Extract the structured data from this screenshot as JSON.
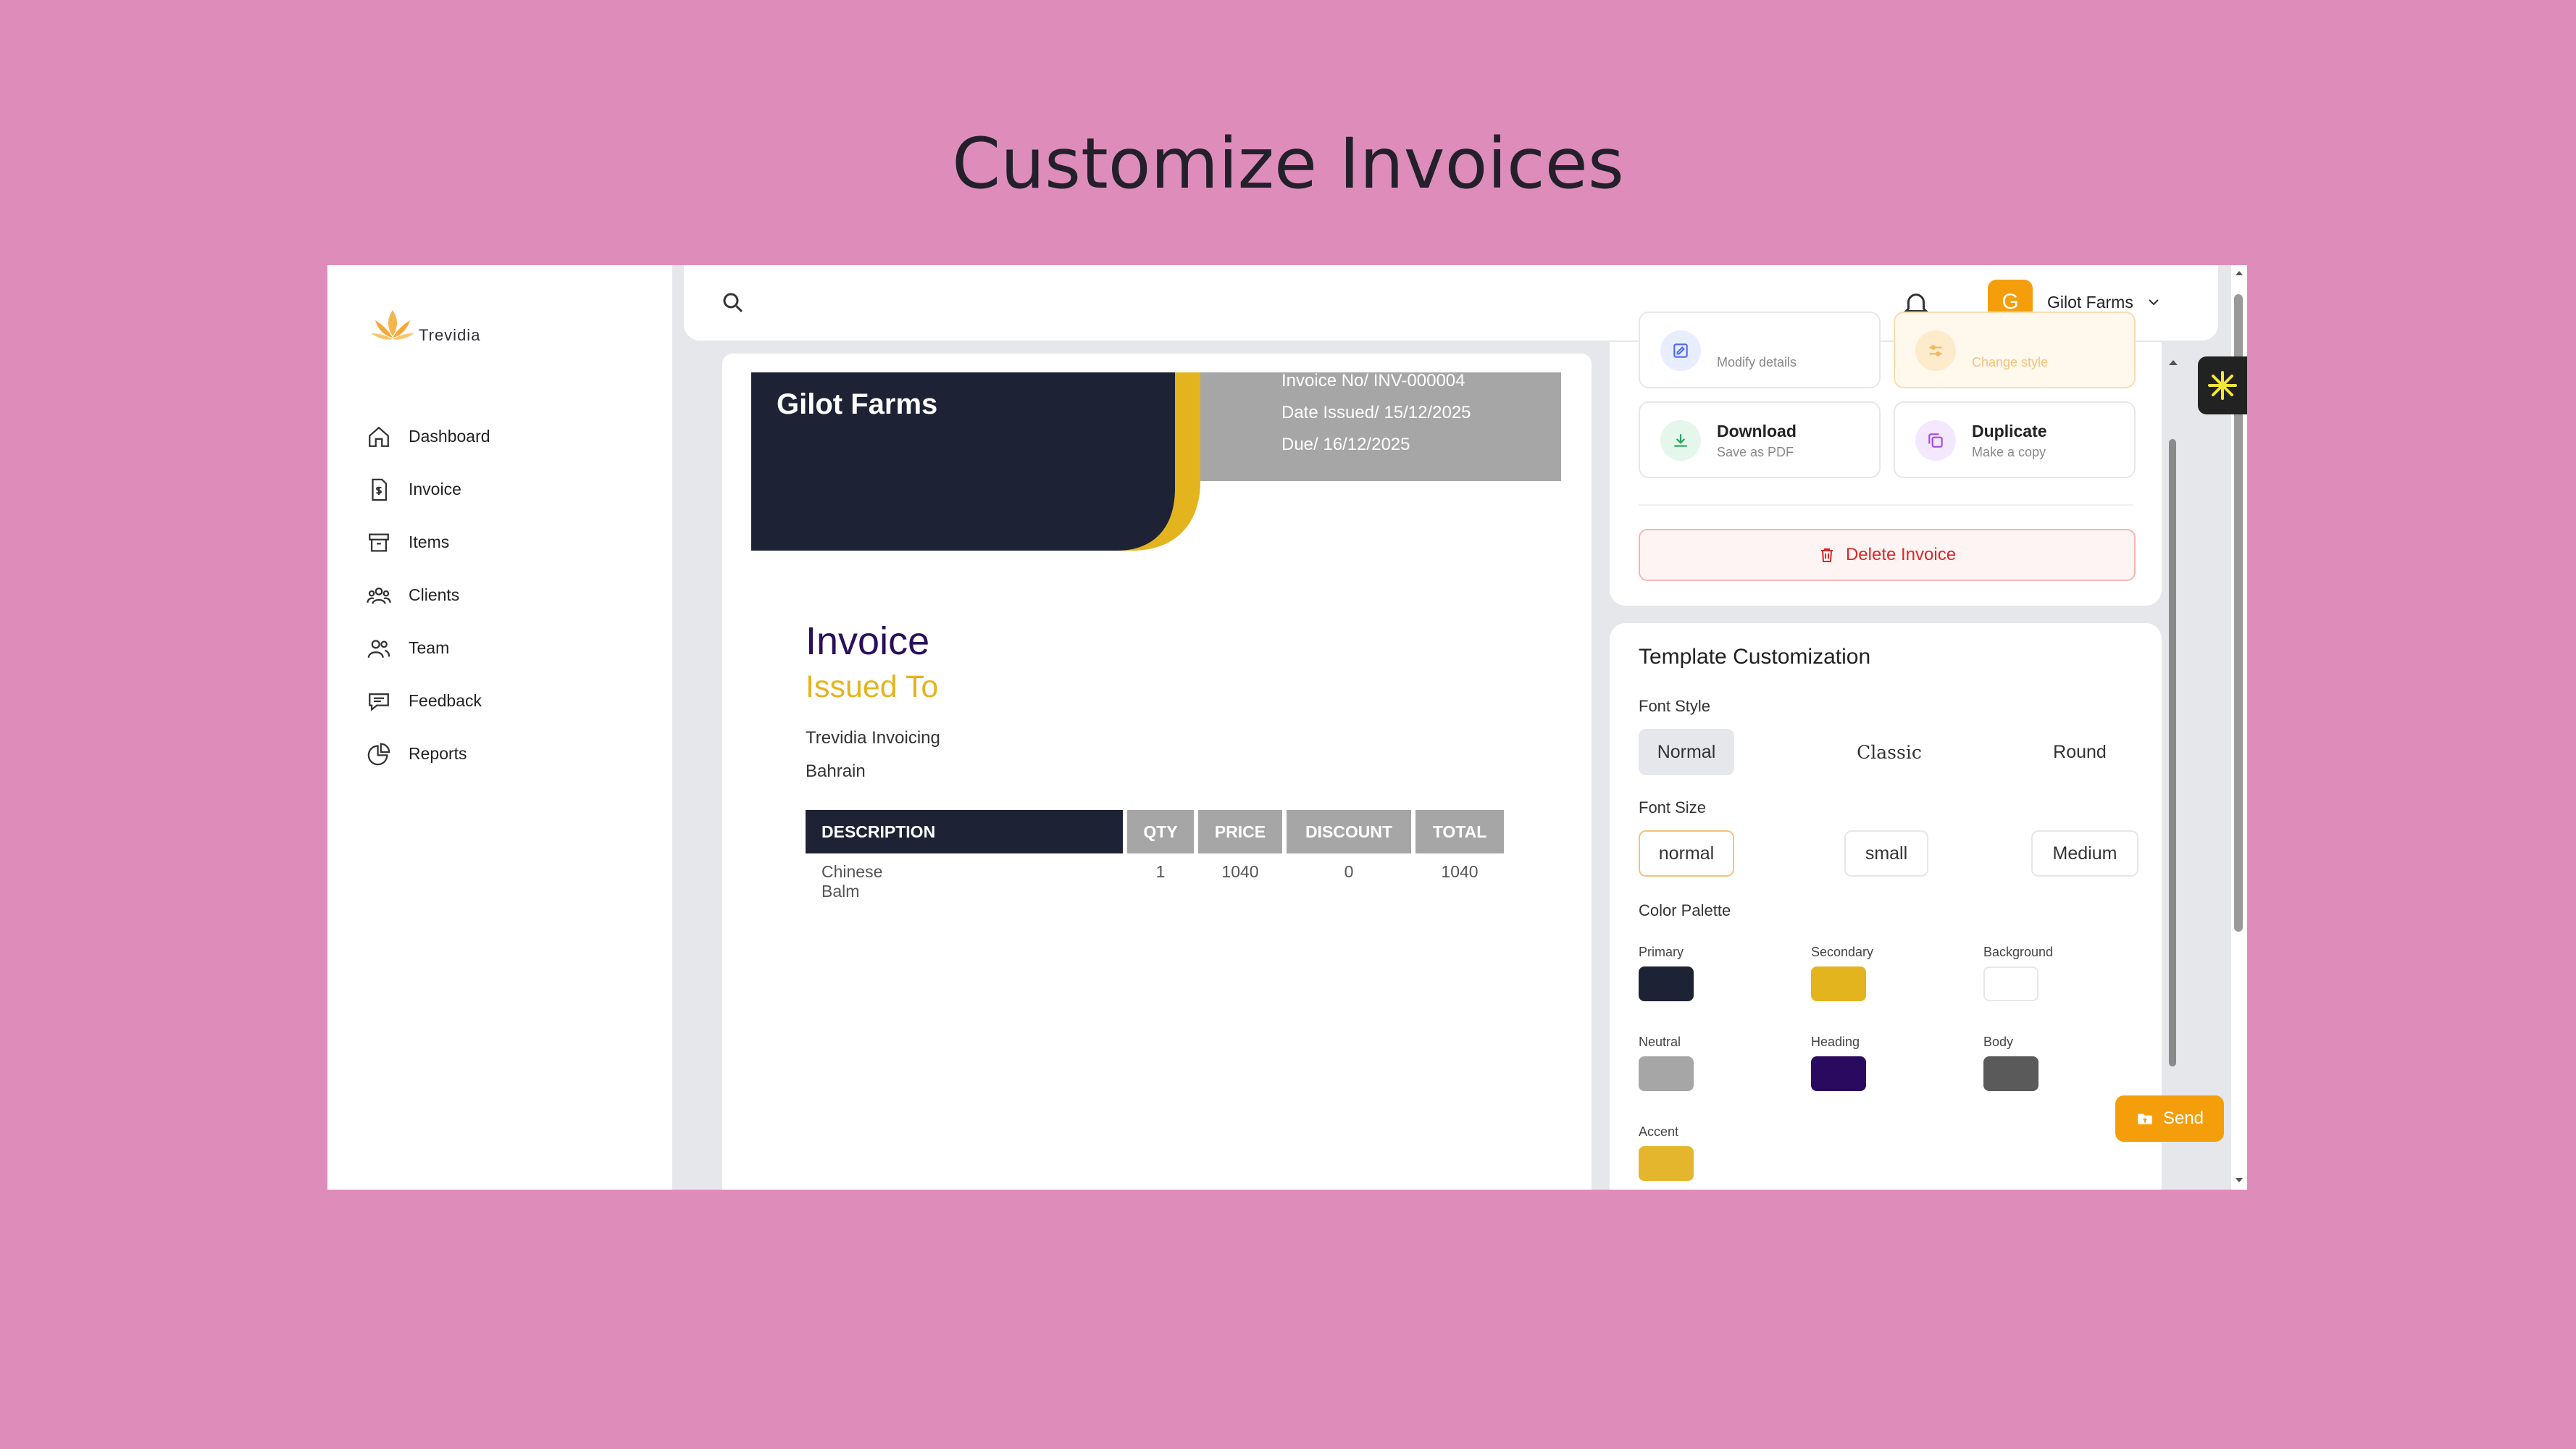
{
  "hero_title": "Customize Invoices",
  "brand": {
    "name": "Trevidia"
  },
  "sidebar": {
    "items": [
      {
        "label": "Dashboard",
        "icon": "home-icon"
      },
      {
        "label": "Invoice",
        "icon": "invoice-icon"
      },
      {
        "label": "Items",
        "icon": "archive-icon"
      },
      {
        "label": "Clients",
        "icon": "clients-icon"
      },
      {
        "label": "Team",
        "icon": "team-icon"
      },
      {
        "label": "Feedback",
        "icon": "feedback-icon"
      },
      {
        "label": "Reports",
        "icon": "reports-icon"
      }
    ]
  },
  "header": {
    "user_initial": "G",
    "user_name": "Gilot Farms"
  },
  "invoice": {
    "company": "Gilot Farms",
    "number": "Invoice No/ INV-000004",
    "date_issued": "Date Issued/ 15/12/2025",
    "due": "Due/ 16/12/2025",
    "title": "Invoice",
    "issued_to_label": "Issued To",
    "client_name": "Trevidia Invoicing",
    "client_location": "Bahrain",
    "columns": [
      "DESCRIPTION",
      "QTY",
      "PRICE",
      "DISCOUNT",
      "TOTAL"
    ],
    "rows": [
      {
        "description": "Chinese Balm",
        "qty": "1",
        "price": "1040",
        "discount": "0",
        "total": "1040"
      }
    ]
  },
  "actions": {
    "edit": {
      "subtitle": "Modify details"
    },
    "customize": {
      "subtitle": "Change style"
    },
    "download": {
      "title": "Download",
      "subtitle": "Save as PDF"
    },
    "duplicate": {
      "title": "Duplicate",
      "subtitle": "Make a copy"
    },
    "delete_label": "Delete Invoice"
  },
  "customization": {
    "title": "Template Customization",
    "font_style_label": "Font Style",
    "font_styles": [
      "Normal",
      "Classic",
      "Round"
    ],
    "font_size_label": "Font Size",
    "font_sizes": [
      "normal",
      "small",
      "Medium"
    ],
    "palette_label": "Color Palette",
    "palette": [
      {
        "name": "Primary",
        "color": "#1E2235"
      },
      {
        "name": "Secondary",
        "color": "#E4B41F"
      },
      {
        "name": "Background",
        "color": "#FFFFFF"
      },
      {
        "name": "Neutral",
        "color": "#A6A6A6"
      },
      {
        "name": "Heading",
        "color": "#2A0A5E"
      },
      {
        "name": "Body",
        "color": "#5A5A5A"
      },
      {
        "name": "Accent",
        "color": "#E4B62E"
      }
    ]
  },
  "send_label": "Send",
  "colors": {
    "background": "#DE8DBB",
    "primary": "#1E2235",
    "secondary": "#E4B41F",
    "neutral": "#A6A6A6",
    "accent_orange": "#F59E0B",
    "danger": "#DC2626"
  }
}
